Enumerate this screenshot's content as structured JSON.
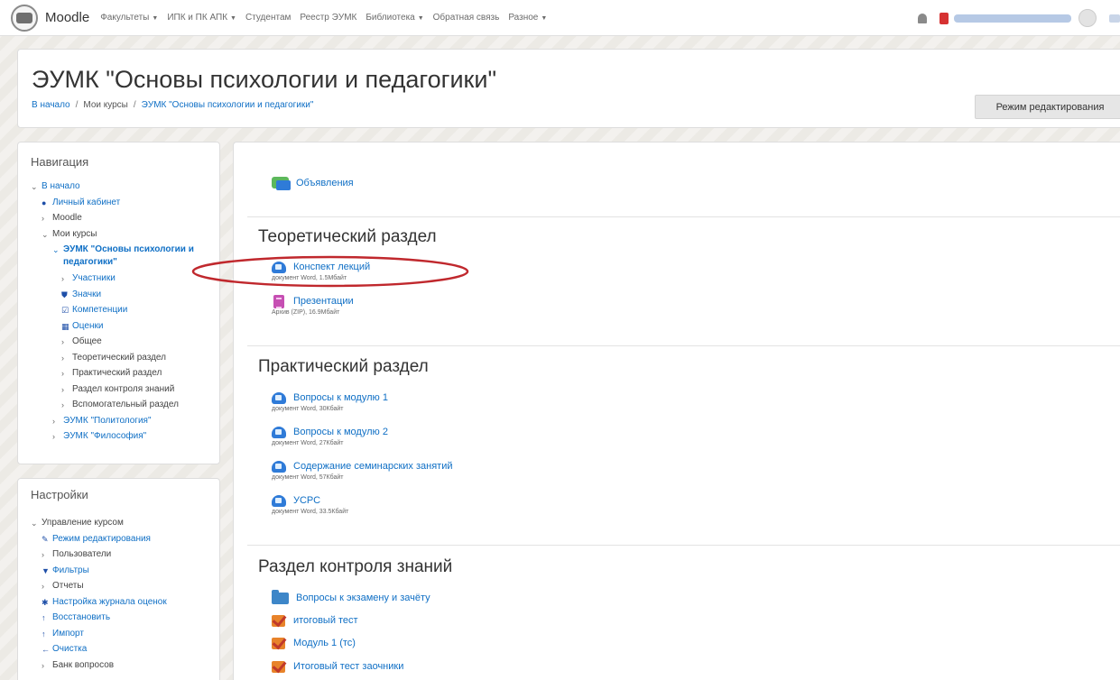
{
  "navbar": {
    "brand": "Moodle",
    "menu": [
      {
        "label": "Факультеты",
        "dropdown": true
      },
      {
        "label": "ИПК и ПК АПК",
        "dropdown": true
      },
      {
        "label": "Студентам",
        "dropdown": false
      },
      {
        "label": "Реестр ЭУМК",
        "dropdown": false
      },
      {
        "label": "Библиотека",
        "dropdown": true
      },
      {
        "label": "Обратная связь",
        "dropdown": false
      },
      {
        "label": "Разное",
        "dropdown": true
      }
    ],
    "icons": [
      "bell-icon",
      "messages-icon",
      "avatar"
    ]
  },
  "header": {
    "title": "ЭУМК \"Основы психологии и педагогики\"",
    "breadcrumb": [
      "В начало",
      "Мои курсы",
      "ЭУМК \"Основы психологии и педагогики\""
    ],
    "breadcrumb_separator": "/",
    "edit_button": "Режим редактирования"
  },
  "navigation": {
    "title": "Навигация",
    "items": [
      {
        "label": "В начало",
        "level": 0,
        "chevron": "down",
        "link": true
      },
      {
        "label": "Личный кабинет",
        "level": 1,
        "icon": "dashboard-icon",
        "link": true
      },
      {
        "label": "Moodle",
        "level": 1,
        "chevron": "right",
        "link": false
      },
      {
        "label": "Мои курсы",
        "level": 1,
        "chevron": "down",
        "link": false
      },
      {
        "label": "ЭУМК \"Основы психологии и педагогики\"",
        "level": 2,
        "chevron": "down",
        "link": true,
        "bold": true
      },
      {
        "label": "Участники",
        "level": 3,
        "chevron": "right",
        "link": true
      },
      {
        "label": "Значки",
        "level": 3,
        "icon": "shield-icon",
        "link": true
      },
      {
        "label": "Компетенции",
        "level": 3,
        "icon": "checkbox-icon",
        "link": true
      },
      {
        "label": "Оценки",
        "level": 3,
        "icon": "table-icon",
        "link": true
      },
      {
        "label": "Общее",
        "level": 3,
        "chevron": "right",
        "link": false
      },
      {
        "label": "Теоретический раздел",
        "level": 3,
        "chevron": "right",
        "link": false
      },
      {
        "label": "Практический раздел",
        "level": 3,
        "chevron": "right",
        "link": false
      },
      {
        "label": "Раздел контроля знаний",
        "level": 3,
        "chevron": "right",
        "link": false
      },
      {
        "label": "Вспомогательный раздел",
        "level": 3,
        "chevron": "right",
        "link": false
      },
      {
        "label": "ЭУМК \"Политология\"",
        "level": 2,
        "chevron": "right",
        "link": true
      },
      {
        "label": "ЭУМК \"Философия\"",
        "level": 2,
        "chevron": "right",
        "link": true
      }
    ]
  },
  "settings": {
    "title": "Настройки",
    "items": [
      {
        "label": "Управление курсом",
        "level": 0,
        "chevron": "down",
        "link": false
      },
      {
        "label": "Режим редактирования",
        "level": 1,
        "icon": "pencil-icon",
        "link": true
      },
      {
        "label": "Пользователи",
        "level": 1,
        "chevron": "right",
        "link": false
      },
      {
        "label": "Фильтры",
        "level": 1,
        "icon": "filter-icon",
        "link": true
      },
      {
        "label": "Отчеты",
        "level": 1,
        "chevron": "right",
        "link": false
      },
      {
        "label": "Настройка журнала оценок",
        "level": 1,
        "icon": "gear-icon",
        "link": true
      },
      {
        "label": "Восстановить",
        "level": 1,
        "icon": "upload-icon",
        "link": true
      },
      {
        "label": "Импорт",
        "level": 1,
        "icon": "upload-icon",
        "link": true
      },
      {
        "label": "Очистка",
        "level": 1,
        "icon": "arrow-left-icon",
        "link": true
      },
      {
        "label": "Банк вопросов",
        "level": 1,
        "chevron": "right",
        "link": false
      }
    ]
  },
  "course": {
    "news": {
      "label": "Объявления",
      "icon": "forum-icon"
    },
    "sections": [
      {
        "title": "Теоретический раздел",
        "activities": [
          {
            "label": "Конспект лекций",
            "meta": "документ Word, 1.5Мбайт",
            "icon": "word-doc-icon"
          },
          {
            "label": "Презентации",
            "meta": "Архив (ZIP), 16.9Мбайт",
            "icon": "zip-archive-icon"
          }
        ]
      },
      {
        "title": "Практический раздел",
        "activities": [
          {
            "label": "Вопросы к модулю 1",
            "meta": "документ Word, 30Кбайт",
            "icon": "word-doc-icon"
          },
          {
            "label": "Вопросы к модулю 2",
            "meta": "документ Word, 27Кбайт",
            "icon": "word-doc-icon"
          },
          {
            "label": "Содержание семинарских занятий",
            "meta": "документ Word, 57Кбайт",
            "icon": "word-doc-icon"
          },
          {
            "label": "УСРС",
            "meta": "документ Word, 33.5Кбайт",
            "icon": "word-doc-icon"
          }
        ]
      },
      {
        "title": "Раздел контроля знаний",
        "activities": [
          {
            "label": "Вопросы к экзамену и зачёту",
            "icon": "folder-icon"
          },
          {
            "label": "итоговый тест",
            "icon": "quiz-icon"
          },
          {
            "label": "Модуль 1 (тс)",
            "icon": "quiz-icon"
          },
          {
            "label": "Итоговый тест заочники",
            "icon": "quiz-icon"
          }
        ]
      }
    ]
  },
  "colors": {
    "link": "#0f6fc5",
    "annotation": "#c0282d",
    "page_background": "#eceae5"
  }
}
